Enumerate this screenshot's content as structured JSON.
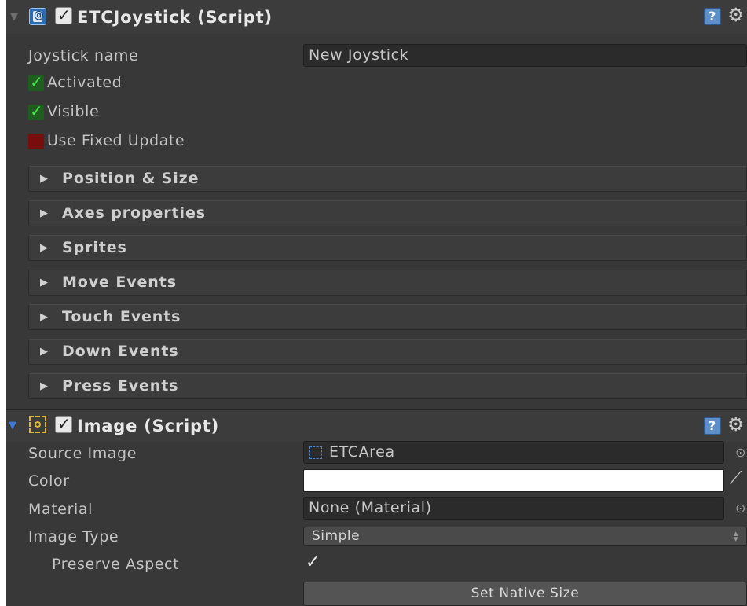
{
  "joystick_component": {
    "title": "ETCJoystick (Script)",
    "enabled": true,
    "name_label": "Joystick name",
    "name_value": "New Joystick",
    "activated_label": "Activated",
    "activated": true,
    "visible_label": "Visible",
    "visible": true,
    "fixed_update_label": "Use Fixed Update",
    "fixed_update": false,
    "sections": [
      {
        "label": "Position & Size"
      },
      {
        "label": "Axes properties"
      },
      {
        "label": "Sprites"
      },
      {
        "label": "Move Events"
      },
      {
        "label": "Touch Events"
      },
      {
        "label": "Down Events"
      },
      {
        "label": "Press Events"
      }
    ]
  },
  "image_component": {
    "title": "Image (Script)",
    "enabled": true,
    "source_label": "Source Image",
    "source_value": "ETCArea",
    "color_label": "Color",
    "color_value": "#ffffff",
    "material_label": "Material",
    "material_value": "None (Material)",
    "type_label": "Image Type",
    "type_value": "Simple",
    "preserve_label": "Preserve Aspect",
    "preserve": true,
    "native_size_button": "Set Native Size"
  },
  "colors": {
    "panel_bg": "#383838",
    "header_bg": "#3c3c3c",
    "field_bg": "#2b2b2b",
    "check_green": "#4fe04f",
    "check_off_red": "#7a0c0c",
    "accent_blue": "#3a7ad8"
  },
  "icons": [
    "foldout-arrow-icon",
    "script-icon",
    "help-icon",
    "gear-icon",
    "image-component-icon",
    "object-picker-icon",
    "eyedropper-icon",
    "dropdown-arrows-icon"
  ]
}
